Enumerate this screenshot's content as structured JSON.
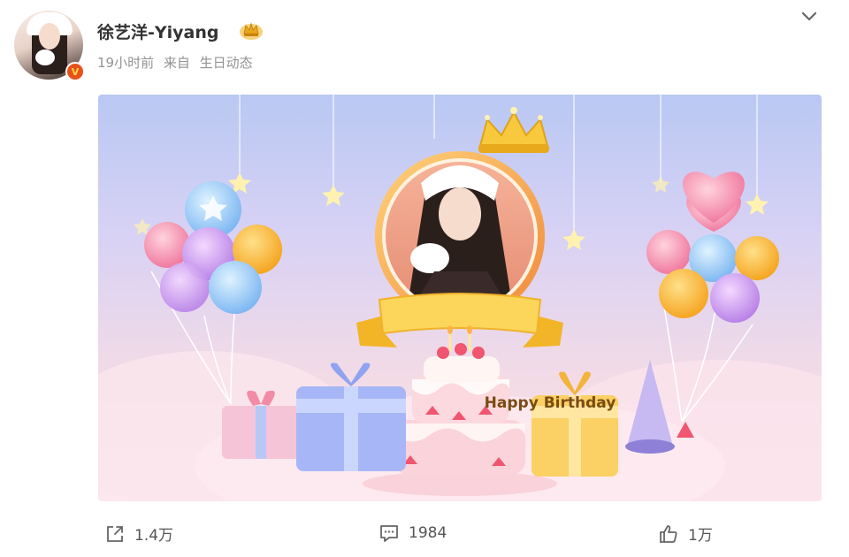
{
  "post": {
    "author": "徐艺洋-Yiyang",
    "time": "19小时前",
    "source_prefix": "来自",
    "source": "生日动态"
  },
  "card": {
    "banner": "Happy Birthday"
  },
  "actions": {
    "share_count": "1.4万",
    "comment_count": "1984",
    "like_count": "1万"
  },
  "colors": {
    "verified": "#e8511a",
    "banner": "#f5c542",
    "text_muted": "#939393"
  },
  "icons": [
    "verified-icon",
    "crown-badge-icon",
    "chevron-down-icon",
    "share-icon",
    "comment-icon",
    "like-icon"
  ]
}
